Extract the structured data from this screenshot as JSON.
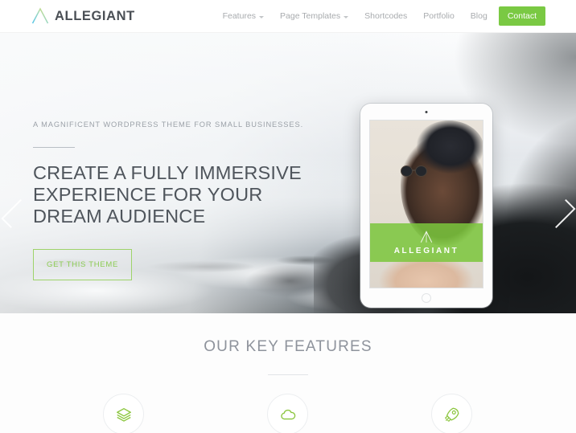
{
  "brand": {
    "name": "ALLEGIANT",
    "logo_icon": "allegiant-a-mark",
    "accent_green": "#7ac943",
    "text_color": "#4a4f55"
  },
  "header": {
    "nav": [
      {
        "label": "Features",
        "has_dropdown": true,
        "icon": "chevron-down-icon"
      },
      {
        "label": "Page Templates",
        "has_dropdown": true,
        "icon": "chevron-down-icon"
      },
      {
        "label": "Shortcodes",
        "has_dropdown": false
      },
      {
        "label": "Portfolio",
        "has_dropdown": false
      },
      {
        "label": "Blog",
        "has_dropdown": false
      }
    ],
    "cta": {
      "label": "Contact",
      "bg": "#7ac943",
      "color": "#ffffff"
    }
  },
  "hero": {
    "eyebrow": "A MAGNIFICENT WORDPRESS THEME FOR SMALL BUSINESSES.",
    "title": "CREATE A FULLY IMMERSIVE EXPERIENCE FOR YOUR DREAM AUDIENCE",
    "button": {
      "label": "GET THIS THEME",
      "border": "#9ed36a",
      "color": "#8ccb53"
    },
    "prev_icon": "chevron-left-icon",
    "next_icon": "chevron-right-icon",
    "background_description": "ocean waves crashing on dark rocks"
  },
  "tablet": {
    "device": "white tablet mockup",
    "screen_band_text": "ALLEGIANT",
    "screen_band_icon": "allegiant-a-mark",
    "screen_band_color": "#7cc63c",
    "photo_description": "woman with sunglasses and beanie"
  },
  "features": {
    "heading": "OUR KEY FEATURES",
    "items": [
      {
        "icon": "layers-icon",
        "color": "#8cc63f"
      },
      {
        "icon": "cloud-icon",
        "color": "#8cc63f"
      },
      {
        "icon": "rocket-icon",
        "color": "#8cc63f"
      }
    ]
  }
}
